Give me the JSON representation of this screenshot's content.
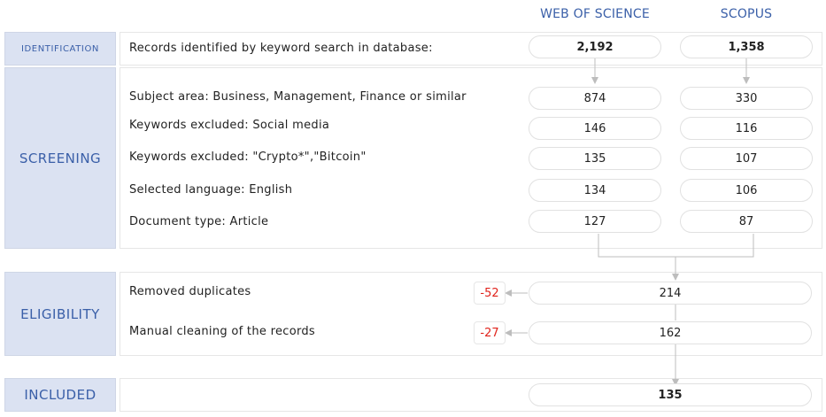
{
  "columns": {
    "wos": "WEB OF SCIENCE",
    "scopus": "SCOPUS"
  },
  "stages": {
    "identification": "IDENTIFICATION",
    "screening": "SCREENING",
    "eligibility": "ELIGIBILITY",
    "included": "INCLUDED"
  },
  "identification": {
    "label": "Records identified by keyword search in database:",
    "wos": "2,192",
    "scopus": "1,358"
  },
  "screening": [
    {
      "label": "Subject area: Business, Management, Finance or similar",
      "wos": "874",
      "scopus": "330"
    },
    {
      "label": "Keywords excluded: Social media",
      "wos": "146",
      "scopus": "116"
    },
    {
      "label": "Keywords excluded: \"Crypto*\",\"Bitcoin\"",
      "wos": "135",
      "scopus": "107"
    },
    {
      "label": "Selected language: English",
      "wos": "134",
      "scopus": "106"
    },
    {
      "label": "Document type: Article",
      "wos": "127",
      "scopus": "87"
    }
  ],
  "eligibility": [
    {
      "label": "Removed duplicates",
      "removed": "-52",
      "value": "214"
    },
    {
      "label": "Manual cleaning of the records",
      "removed": "-27",
      "value": "162"
    }
  ],
  "included": {
    "value": "135"
  },
  "colors": {
    "accent": "#3a5fa8",
    "stage_bg": "#dbe2f2",
    "negative": "#e0221b",
    "connector": "#bdbdbd"
  }
}
